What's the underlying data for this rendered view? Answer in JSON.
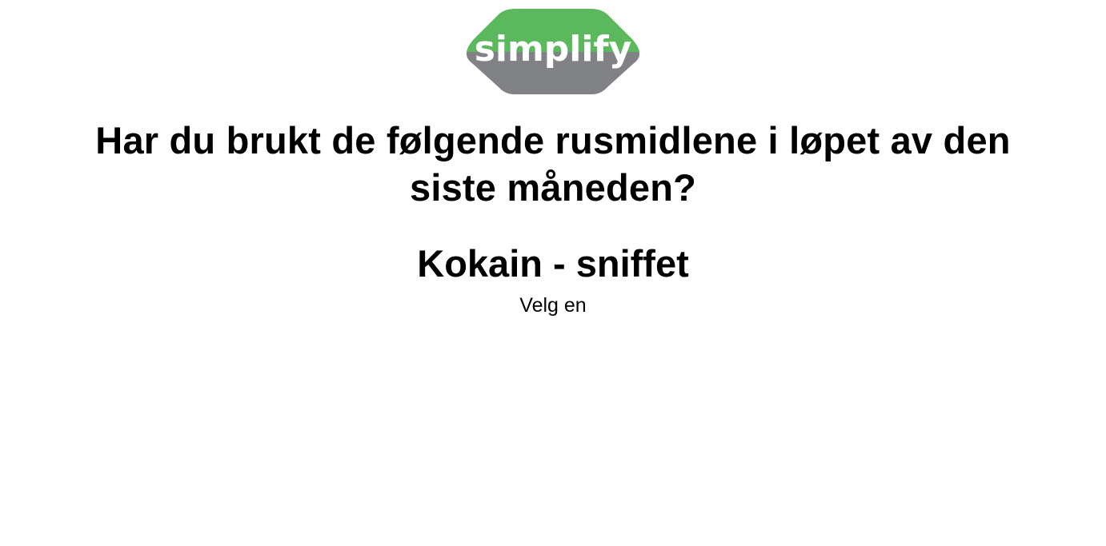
{
  "logo": {
    "text": "simplify",
    "colors": {
      "top": "#5cb85c",
      "bottom": "#818285",
      "text": "#ffffff"
    }
  },
  "question": {
    "text": "Har du brukt de følgende rusmidlene i løpet av den siste måneden?"
  },
  "item": {
    "title": "Kokain - sniffet"
  },
  "prompt": {
    "label": "Velg en"
  }
}
